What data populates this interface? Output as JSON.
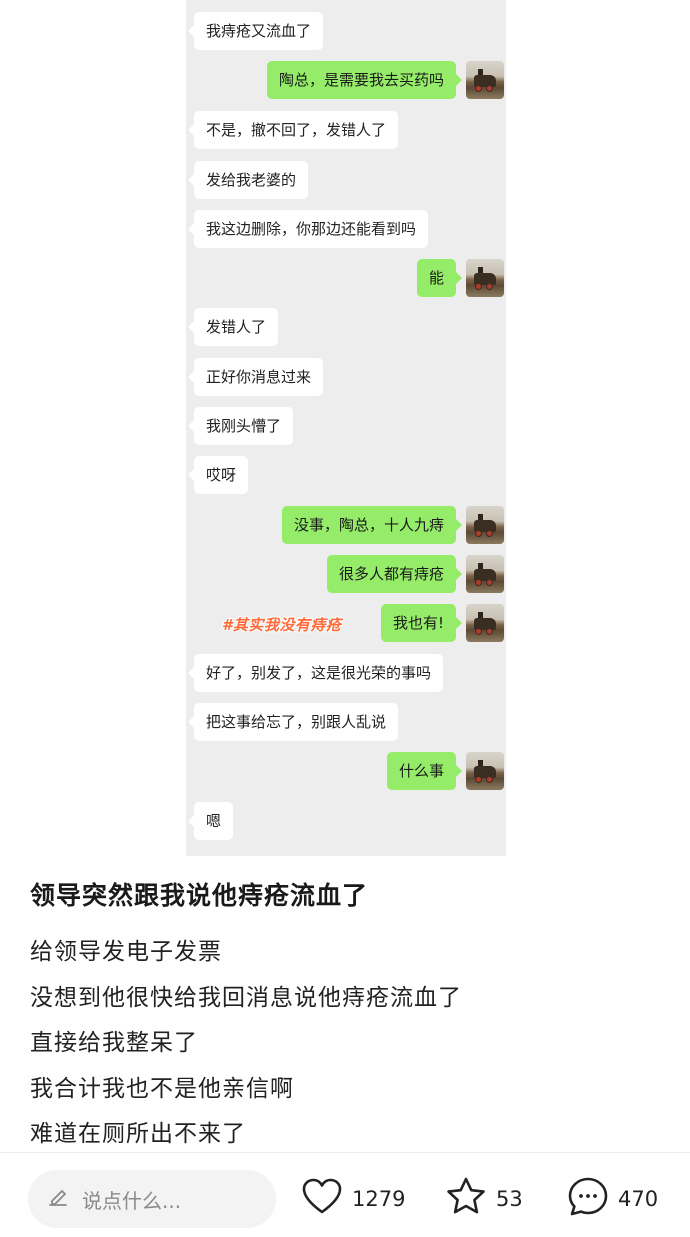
{
  "chat": {
    "messages": [
      {
        "side": "left",
        "text": "我痔疮又流血了"
      },
      {
        "side": "right",
        "text": "陶总，是需要我去买药吗"
      },
      {
        "side": "left",
        "text": "不是，撤不回了，发错人了"
      },
      {
        "side": "left",
        "text": "发给我老婆的"
      },
      {
        "side": "left",
        "text": "我这边删除，你那边还能看到吗"
      },
      {
        "side": "right",
        "text": "能"
      },
      {
        "side": "left",
        "text": "发错人了"
      },
      {
        "side": "left",
        "text": "正好你消息过来"
      },
      {
        "side": "left",
        "text": "我刚头懵了"
      },
      {
        "side": "left",
        "text": "哎呀"
      },
      {
        "side": "right",
        "text": "没事，陶总，十人九痔"
      },
      {
        "side": "right",
        "text": "很多人都有痔疮"
      },
      {
        "side": "right",
        "text": "我也有!"
      },
      {
        "side": "left",
        "text": "好了，别发了，这是很光荣的事吗"
      },
      {
        "side": "left",
        "text": "把这事给忘了，别跟人乱说"
      },
      {
        "side": "right",
        "text": "什么事"
      },
      {
        "side": "left",
        "text": "嗯"
      }
    ],
    "sticker_text": "#其实我没有痔疮"
  },
  "post": {
    "title": "领导突然跟我说他痔疮流血了",
    "lines": [
      "给领导发电子发票",
      "没想到他很快给我回消息说他痔疮流血了",
      "直接给我整呆了",
      "我合计我也不是他亲信啊",
      "难道在厕所出不来了"
    ]
  },
  "bottom_bar": {
    "comment_placeholder": "说点什么...",
    "like_count": "1279",
    "star_count": "53",
    "comment_count": "470"
  },
  "colors": {
    "sent_bubble": "#95ec69",
    "received_bubble": "#ffffff",
    "chat_background": "#ededed"
  }
}
